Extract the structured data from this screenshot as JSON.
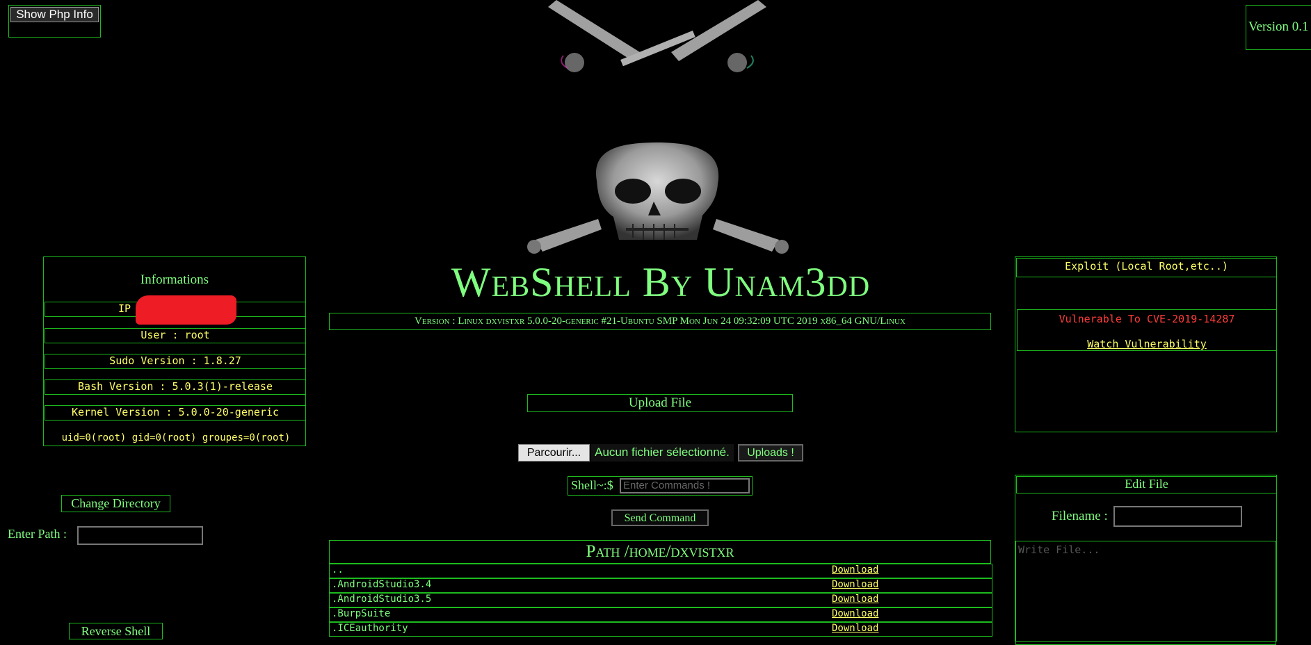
{
  "top": {
    "php_info_label": "Show Php Info",
    "version_label": "Version 0.1"
  },
  "header": {
    "title": "WebShell By Unam3dd",
    "version_line": "Version : Linux dxvistxr 5.0.0-20-generic #21-Ubuntu SMP Mon Jun 24 09:32:09 UTC 2019 x86_64 GNU/Linux"
  },
  "info": {
    "title": "Informations",
    "ip_label": "IP",
    "user": "User : root",
    "sudo": "Sudo Version : 1.8.27",
    "bash": "Bash Version : 5.0.3(1)-release",
    "kernel": "Kernel Version : 5.0.0-20-generic",
    "ids": "uid=0(root) gid=0(root) groupes=0(root)"
  },
  "left": {
    "change_dir": "Change Directory",
    "enter_path": "Enter Path :",
    "reverse_shell": "Reverse Shell"
  },
  "upload": {
    "title": "Upload File",
    "browse": "Parcourir...",
    "no_file": "Aucun fichier sélectionné.",
    "submit": "Uploads !"
  },
  "shell": {
    "prompt": "Shell~:$",
    "placeholder": "Enter Commands !",
    "send": "Send Command"
  },
  "files": {
    "path": "Path /home/dxvistxr",
    "download_label": "Download",
    "rows": [
      {
        "name": ".."
      },
      {
        "name": ".AndroidStudio3.4"
      },
      {
        "name": ".AndroidStudio3.5"
      },
      {
        "name": ".BurpSuite"
      },
      {
        "name": ".ICEauthority"
      }
    ]
  },
  "exploit": {
    "title": "Exploit (Local Root,etc..)",
    "vuln": "Vulnerable To CVE-2019-14287",
    "watch": "Watch Vulnerability"
  },
  "edit": {
    "title": "Edit File",
    "filename_label": "Filename :",
    "write_placeholder": "Write File..."
  },
  "colors": {
    "background": "#000000",
    "text_green": "#7fff7f",
    "border_green": "#1dbb1d",
    "yellow": "#ffff66",
    "red": "#ff3b3b",
    "redaction": "#ee1c25"
  },
  "icons": {
    "hero": "skull-crossbones-icon"
  }
}
